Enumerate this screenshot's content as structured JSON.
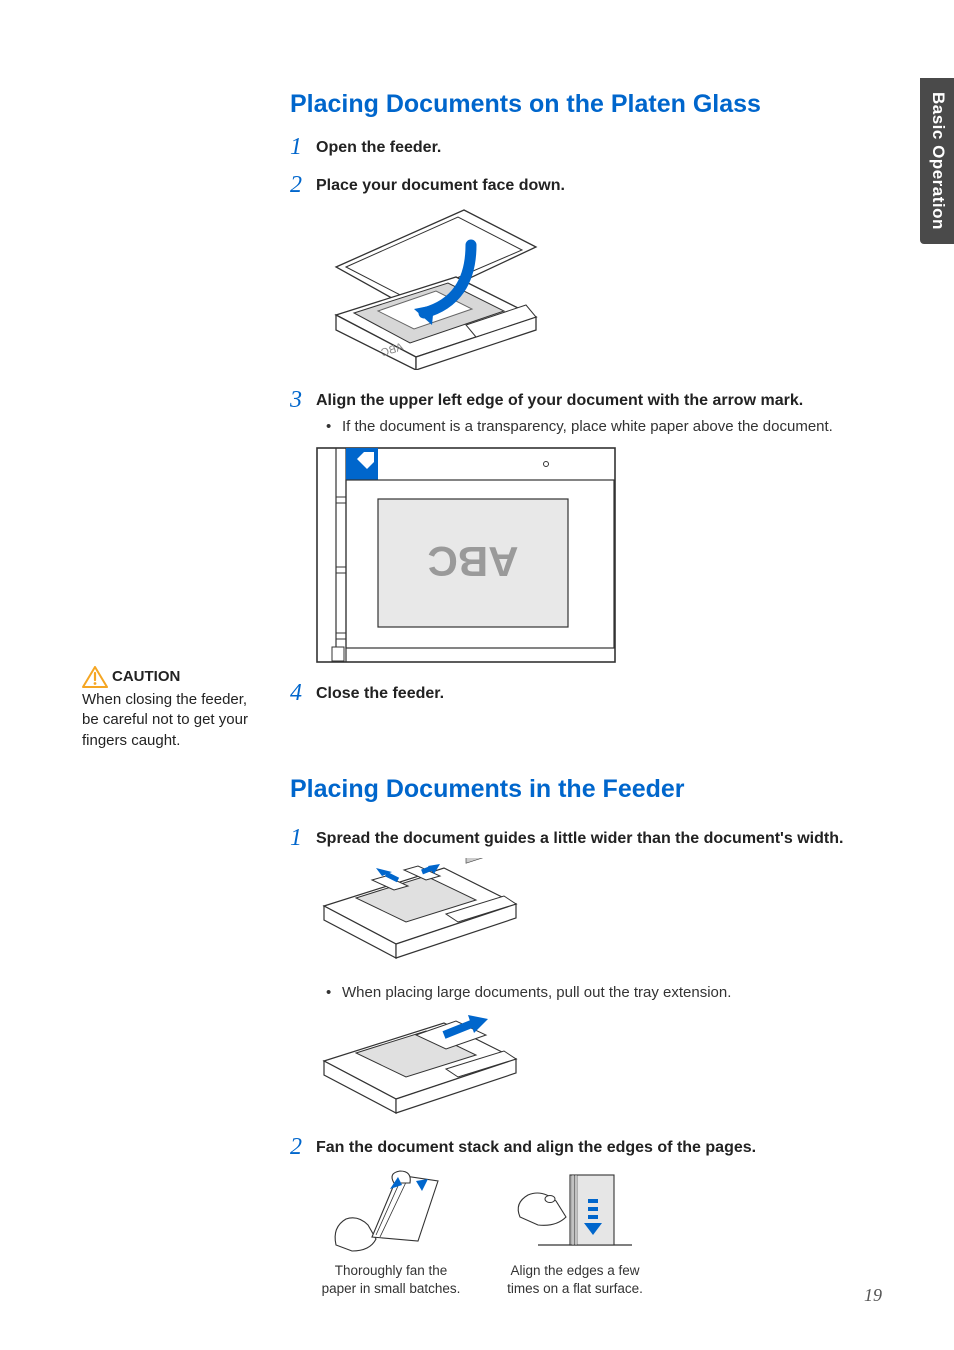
{
  "sideTab": "Basic Operation",
  "pageNumber": "19",
  "caution": {
    "label": "CAUTION",
    "text": "When closing the feeder, be careful not to get your fingers caught."
  },
  "section1": {
    "title": "Placing Documents on the Platen Glass",
    "step1": {
      "title": "Open the feeder."
    },
    "step2": {
      "title": "Place your document face down."
    },
    "step3": {
      "title": "Align the upper left edge of your document with the arrow mark.",
      "bullet": "If the document is a transparency, place white paper above the document."
    },
    "step4": {
      "title": "Close the feeder."
    },
    "platenText": "ABC"
  },
  "section2": {
    "title": "Placing Documents in the Feeder",
    "step1": {
      "title": "Spread the document guides a little wider than the document's width.",
      "bullet": "When placing large documents, pull out the tray extension."
    },
    "step2": {
      "title": "Fan the document stack and align the edges of the pages.",
      "cap1": "Thoroughly fan the paper in small batches.",
      "cap2": "Align the edges a few times on a flat surface."
    }
  }
}
